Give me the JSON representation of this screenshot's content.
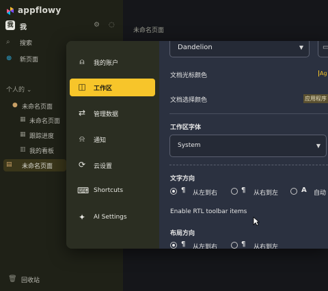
{
  "app": {
    "logo_text": "appflowy"
  },
  "sidebar": {
    "workspace_initial": "我",
    "workspace_name": "我",
    "search_label": "搜索",
    "new_page_label": "新页面",
    "section_label": "个人的",
    "section_caret": "⌄",
    "pages": [
      {
        "label": "未命名页面",
        "icon": "doc-icon"
      },
      {
        "label": "未命名页面",
        "icon": "grid-icon"
      },
      {
        "label": "跟踪进度",
        "icon": "grid-icon"
      },
      {
        "label": "我的看板",
        "icon": "board-icon"
      },
      {
        "label": "未命名页面",
        "icon": "doc-icon",
        "selected": true
      }
    ],
    "trash_label": "回收站"
  },
  "main": {
    "title": "未命名页面"
  },
  "settings": {
    "nav": [
      {
        "label": "我的账户",
        "icon": "person-icon",
        "glyph": "⍝"
      },
      {
        "label": "工作区",
        "icon": "workspace-icon",
        "glyph": "◫",
        "active": true
      },
      {
        "label": "管理数据",
        "icon": "data-icon",
        "glyph": "⇄"
      },
      {
        "label": "通知",
        "icon": "bell-icon",
        "glyph": "⍾"
      },
      {
        "label": "云设置",
        "icon": "sync-icon",
        "glyph": "⟳"
      },
      {
        "label": "Shortcuts",
        "icon": "keyboard-icon",
        "glyph": "⌨"
      },
      {
        "label": "AI Settings",
        "icon": "ai-icon",
        "glyph": "✦"
      }
    ],
    "theme_value": "Dandelion",
    "cursor_color_label": "文档光标颜色",
    "cursor_color_swatch": "Ag",
    "selection_color_label": "文档选择颜色",
    "selection_color_swatch": "应用程序",
    "font_section_label": "工作区字体",
    "font_value": "System",
    "text_direction_label": "文字方向",
    "text_direction_options": [
      "从左到右",
      "从右到左",
      "自动"
    ],
    "text_direction_selected": "从左到右",
    "rtl_toolbar_label": "Enable RTL toolbar items",
    "layout_direction_label": "布局方向",
    "layout_direction_options": [
      "从左到右",
      "从右到左"
    ],
    "layout_direction_selected": "从左到右"
  },
  "colors": {
    "accent": "#f7c52a",
    "sidebar_bg": "#1f2117",
    "dialog_bg": "#2b3140"
  }
}
